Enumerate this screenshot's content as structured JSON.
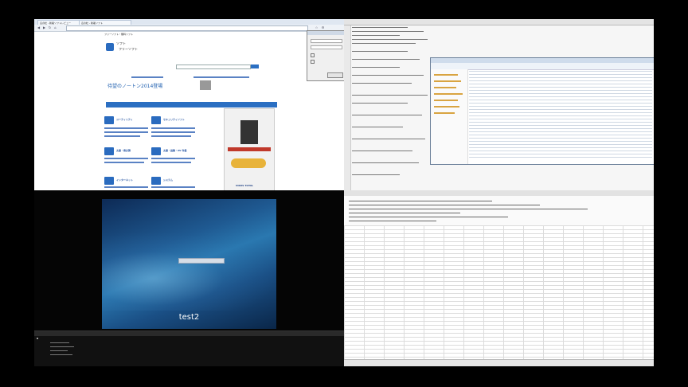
{
  "browser": {
    "tabs": [
      "窓の杜 - 新着ソフトレビュー",
      "窓の杜 - 新着ソフト"
    ],
    "site": {
      "nav_left": "フリーソフト・無料ソフト",
      "logo_line1": "ソフト",
      "logo_line2": "フリーソフト",
      "promo_title": "待望のノートン2014登場",
      "categories": [
        "ユーティリティ",
        "セキュリティソフト",
        "文書・表計算",
        "文書・画像・AV 作業",
        "インターネット",
        "システム"
      ],
      "ad_bottom": "VIRUS TOTAL"
    }
  },
  "vm": {
    "user_label": "test2"
  },
  "colors": {
    "accent": "#2b6fc2",
    "vm_background": "#1f5a92"
  }
}
